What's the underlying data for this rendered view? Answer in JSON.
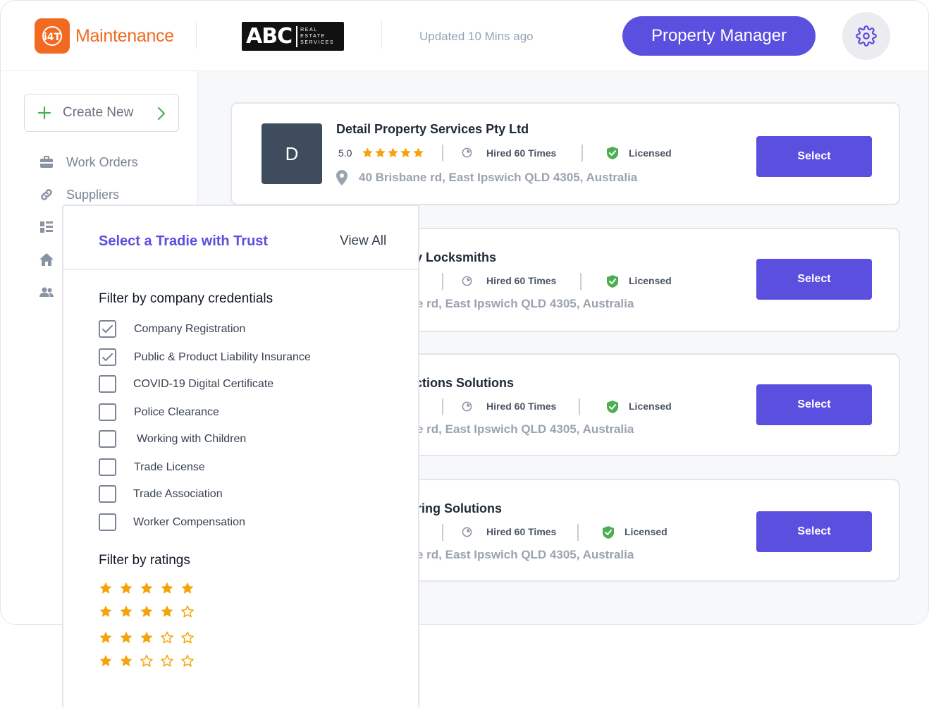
{
  "header": {
    "app_name": "Maintenance",
    "logo_letters": "ABC",
    "logo_sub_lines": [
      "REAL",
      "ESTATE",
      "SERVICES"
    ],
    "updated_text": "Updated 10 Mins ago",
    "role_button": "Property Manager",
    "settings_icon": "gear-icon"
  },
  "sidebar": {
    "create_label": "Create New",
    "items": [
      {
        "label": "Work Orders",
        "icon": "briefcase-icon"
      },
      {
        "label": "Suppliers",
        "icon": "link-icon"
      },
      {
        "label": "",
        "icon": "dashboard-icon"
      },
      {
        "label": "",
        "icon": "home-icon"
      },
      {
        "label": "",
        "icon": "people-icon"
      }
    ]
  },
  "suppliers": [
    {
      "avatar": "D",
      "name": "Detail Property Services Pty Ltd",
      "rating": "5.0",
      "hired": "Hired 60 Times",
      "license": "Licensed",
      "address": "40 Brisbane rd, East Ipswich QLD 4305, Australia",
      "select": "Select"
    },
    {
      "avatar": "",
      "name": "y Locksmiths",
      "rating": "",
      "hired": "Hired 60 Times",
      "license": "Licensed",
      "address": "e rd, East Ipswich QLD 4305, Australia",
      "select": "Select"
    },
    {
      "avatar": "",
      "name": "ctions Solutions",
      "rating": "",
      "hired": "Hired 60 Times",
      "license": "Licensed",
      "address": "e rd, East Ipswich QLD 4305, Australia",
      "select": "Select"
    },
    {
      "avatar": "",
      "name": "ring Solutions",
      "rating": "",
      "hired": "Hired 60 Times",
      "license": "Licensed",
      "address": "e rd, East Ipswich QLD 4305, Australia",
      "select": "Select"
    }
  ],
  "filter_panel": {
    "title": "Select a Tradie with Trust",
    "view_all": "View All",
    "credentials_title": "Filter by company credentials",
    "credentials": [
      {
        "label": "Company Registration",
        "checked": true
      },
      {
        "label": "Public & Product Liability Insurance",
        "checked": true
      },
      {
        "label": "COVID-19 Digital Certificate",
        "checked": false
      },
      {
        "label": "Police Clearance",
        "checked": false
      },
      {
        "label": "Working with Children",
        "checked": false
      },
      {
        "label": "Trade License",
        "checked": false
      },
      {
        "label": "Trade Association",
        "checked": false
      },
      {
        "label": "Worker Compensation",
        "checked": false
      }
    ],
    "ratings_title": "Filter by ratings",
    "ratings": [
      5,
      4,
      3,
      2
    ]
  },
  "colors": {
    "accent": "#5b4fe0",
    "brand_orange": "#f26a21",
    "star": "#f5a30b",
    "license_green": "#4caf50"
  }
}
